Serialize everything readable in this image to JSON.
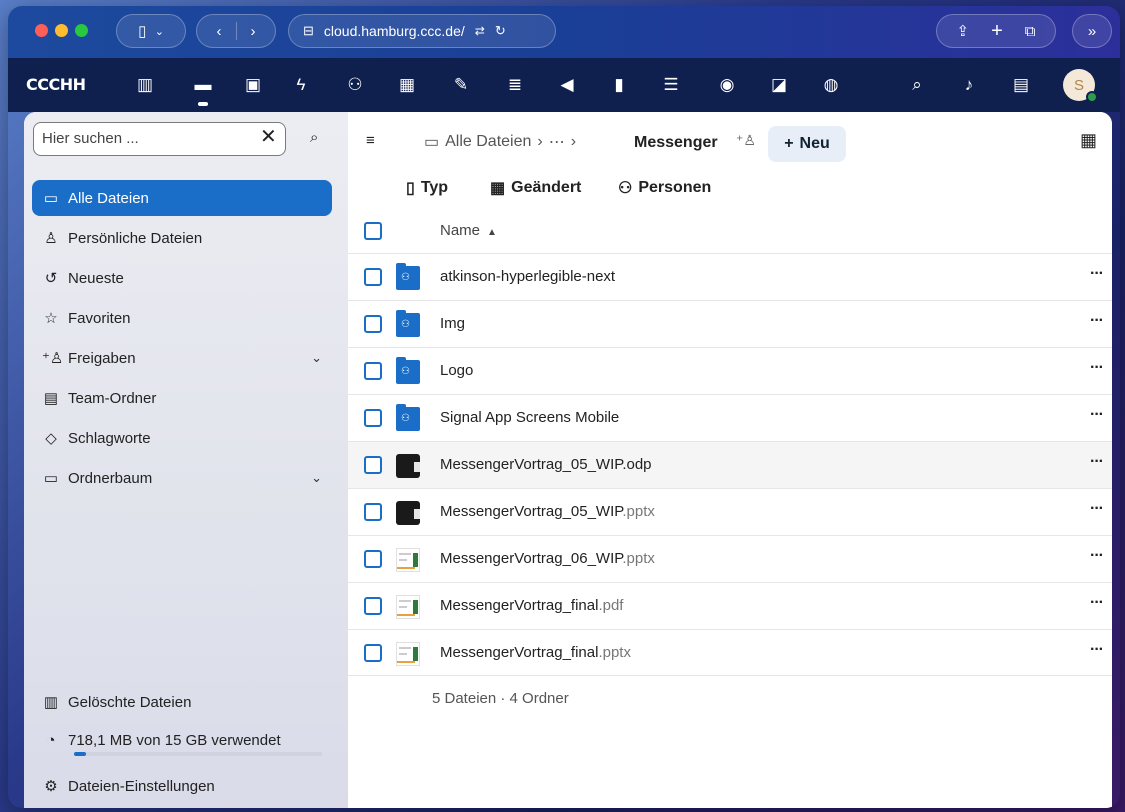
{
  "browser": {
    "url_host": "cloud.hamburg.ccc.de/",
    "icons": [
      "sidebar-icon",
      "chevron-down-icon",
      "back-icon",
      "forward-icon",
      "translate-icon",
      "reload-icon",
      "share-icon",
      "new-tab-icon",
      "tabs-icon",
      "extensions-icon"
    ]
  },
  "app_header": {
    "logo": "CCCHH",
    "apps": [
      "dashboard-icon",
      "files-icon",
      "photos-icon",
      "activity-icon",
      "contacts-icon",
      "calendar-icon",
      "notes-icon",
      "deck-icon",
      "announcements-icon",
      "analytics-icon",
      "tasks-icon",
      "talk-icon",
      "forms-icon",
      "passwords-icon"
    ],
    "avatar_letter": "S"
  },
  "sidebar": {
    "search_placeholder": "Hier suchen ...",
    "items": [
      {
        "label": "Alle Dateien",
        "icon": "folder-icon"
      },
      {
        "label": "Persönliche Dateien",
        "icon": "person-icon"
      },
      {
        "label": "Neueste",
        "icon": "history-icon"
      },
      {
        "label": "Favoriten",
        "icon": "star-icon"
      },
      {
        "label": "Freigaben",
        "icon": "share-person-icon"
      },
      {
        "label": "Team-Ordner",
        "icon": "team-folder-icon"
      },
      {
        "label": "Schlagworte",
        "icon": "tag-icon"
      },
      {
        "label": "Ordnerbaum",
        "icon": "folder-tree-icon"
      }
    ],
    "trash": "Gelöschte Dateien",
    "quota": "718,1 MB von 15 GB verwendet",
    "quota_fraction": 0.05,
    "settings": "Dateien-Einstellungen"
  },
  "main": {
    "breadcrumb_root": "Alle Dateien",
    "breadcrumb_more": "⋯",
    "breadcrumb_current": "Messenger",
    "new_button": "Neu",
    "filters": {
      "type": "Typ",
      "modified": "Geändert",
      "people": "Personen"
    },
    "name_header": "Name",
    "rows": [
      {
        "name": "atkinson-hyperlegible-next",
        "ext": "",
        "kind": "folder"
      },
      {
        "name": "Img",
        "ext": "",
        "kind": "folder"
      },
      {
        "name": "Logo",
        "ext": "",
        "kind": "folder"
      },
      {
        "name": "Signal App Screens Mobile",
        "ext": "",
        "kind": "folder"
      },
      {
        "name": "MessengerVortrag_05_WIP.odp",
        "ext": "",
        "kind": "dark"
      },
      {
        "name": "MessengerVortrag_05_WIP",
        "ext": ".pptx",
        "kind": "dark"
      },
      {
        "name": "MessengerVortrag_06_WIP",
        "ext": ".pptx",
        "kind": "light"
      },
      {
        "name": "MessengerVortrag_final",
        "ext": ".pdf",
        "kind": "light"
      },
      {
        "name": "MessengerVortrag_final",
        "ext": ".pptx",
        "kind": "light"
      }
    ],
    "summary": "5 Dateien · 4 Ordner"
  }
}
